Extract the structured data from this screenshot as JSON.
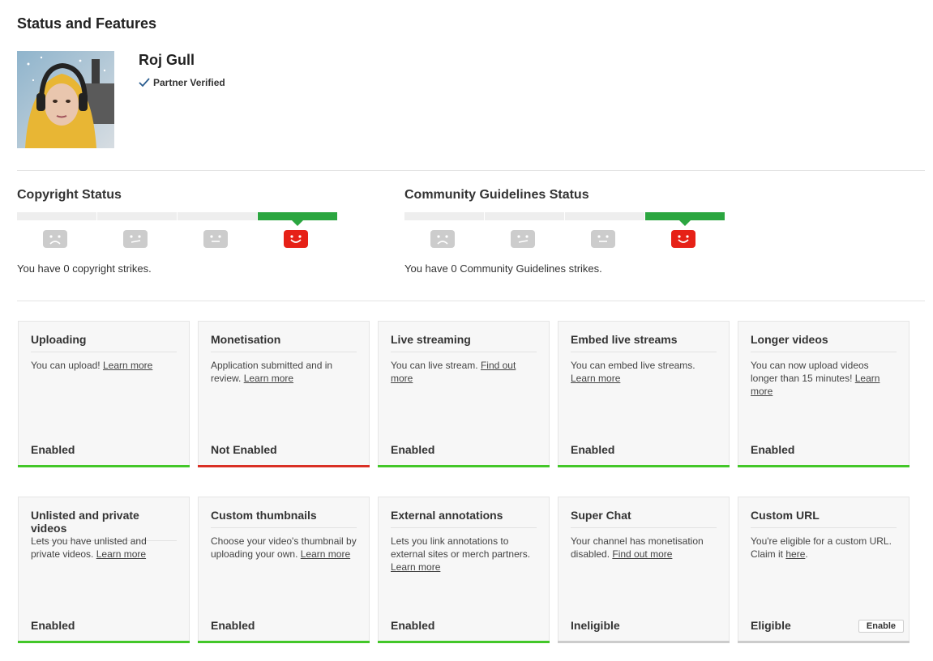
{
  "page_title": "Status and Features",
  "channel": {
    "name": "Roj Gull",
    "verified_label": "Partner Verified"
  },
  "copyright": {
    "title": "Copyright Status",
    "strikes_text": "You have 0 copyright strikes.",
    "strikes": 0
  },
  "community": {
    "title": "Community Guidelines Status",
    "strikes_text": "You have 0 Community Guidelines strikes.",
    "strikes": 0
  },
  "colors": {
    "green": "#2ba640",
    "red": "#e62117",
    "enabled_bar": "#43c729",
    "not_enabled_bar": "#d93025",
    "neutral_bar": "#cccccc"
  },
  "features": [
    {
      "title": "Uploading",
      "desc": "You can upload! ",
      "link": "Learn more",
      "desc_after": "",
      "state": "Enabled",
      "status": "enabled"
    },
    {
      "title": "Monetisation",
      "desc": "Application submitted and in review. ",
      "link": "Learn more",
      "desc_after": "",
      "state": "Not Enabled",
      "status": "disabled"
    },
    {
      "title": "Live streaming",
      "desc": "You can live stream. ",
      "link": "Find out more",
      "desc_after": "",
      "state": "Enabled",
      "status": "enabled"
    },
    {
      "title": "Embed live streams",
      "desc": "You can embed live streams. ",
      "link": "Learn more",
      "desc_after": "",
      "state": "Enabled",
      "status": "enabled"
    },
    {
      "title": "Longer videos",
      "desc": "You can now upload videos longer than 15 minutes! ",
      "link": "Learn more",
      "desc_after": "",
      "state": "Enabled",
      "status": "enabled"
    },
    {
      "title": "Unlisted and private videos",
      "desc": "Lets you have unlisted and private videos. ",
      "link": "Learn more",
      "desc_after": "",
      "state": "Enabled",
      "status": "enabled"
    },
    {
      "title": "Custom thumbnails",
      "desc": "Choose your video's thumbnail by uploading your own. ",
      "link": "Learn more",
      "desc_after": "",
      "state": "Enabled",
      "status": "enabled"
    },
    {
      "title": "External annotations",
      "desc": "Lets you link annotations to external sites or merch partners. ",
      "link": "Learn more",
      "desc_after": "",
      "state": "Enabled",
      "status": "enabled"
    },
    {
      "title": "Super Chat",
      "desc": "Your channel has monetisation disabled. ",
      "link": "Find out more",
      "desc_after": "",
      "state": "Ineligible",
      "status": "neutral"
    },
    {
      "title": "Custom URL",
      "desc": "You're eligible for a custom URL. Claim it ",
      "link": "here",
      "desc_after": ".",
      "state": "Eligible",
      "status": "neutral",
      "button": "Enable"
    }
  ]
}
